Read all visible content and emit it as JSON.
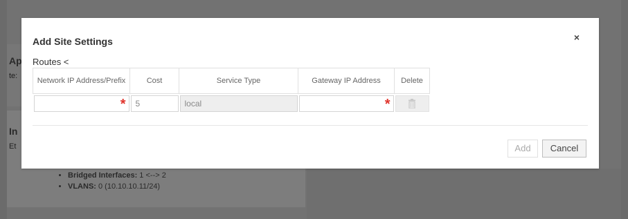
{
  "background": {
    "section1_title": "Ap",
    "section1_text": "te:",
    "section2_title": "In",
    "section2_text": "Et",
    "bullets": [
      {
        "label": "Bridged Interfaces:",
        "value": " 1 <--> 2"
      },
      {
        "label": "VLANS:",
        "value": " 0 (10.10.10.11/24)"
      }
    ]
  },
  "modal": {
    "title": "Add Site Settings",
    "close_label": "×",
    "routes_label": "Routes <",
    "table": {
      "headers": [
        "Network IP Address/Prefix",
        "Cost",
        "Service Type",
        "Gateway IP Address",
        "Delete"
      ],
      "row": {
        "network": "",
        "cost": "5",
        "service_type": "local",
        "gateway": "",
        "required_marker": "*"
      }
    },
    "buttons": {
      "add": "Add",
      "cancel": "Cancel"
    }
  },
  "colors": {
    "required": "#e0332b",
    "overlay": "#6b6b6b"
  }
}
